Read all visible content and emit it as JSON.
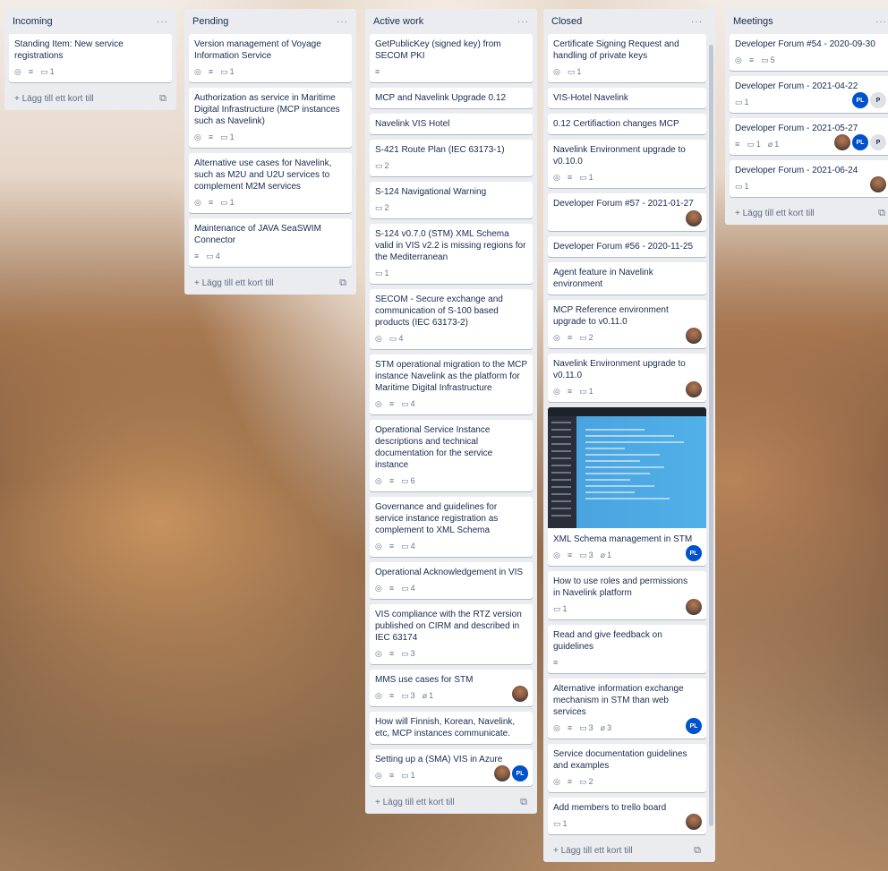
{
  "labels": {
    "add_card": "+ Lägg till ett kort till",
    "menu": "···"
  },
  "lists": [
    {
      "title": "Incoming",
      "cards": [
        {
          "title": "Standing Item: New service registrations",
          "badges": {
            "watch": true,
            "desc": true,
            "comments": "1"
          }
        }
      ]
    },
    {
      "title": "Pending",
      "cards": [
        {
          "title": "Version management of Voyage Information Service",
          "badges": {
            "watch": true,
            "desc": true,
            "comments": "1"
          }
        },
        {
          "title": "Authorization as service in Maritime Digital Infrastructure (MCP instances such as Navelink)",
          "badges": {
            "watch": true,
            "desc": true,
            "comments": "1"
          }
        },
        {
          "title": "Alternative use cases for Navelink, such as M2U and U2U services to complement M2M services",
          "badges": {
            "watch": true,
            "desc": true,
            "comments": "1"
          }
        },
        {
          "title": "Maintenance of JAVA SeaSWIM Connector",
          "badges": {
            "desc": true,
            "comments": "4"
          }
        }
      ]
    },
    {
      "title": "Active work",
      "cards": [
        {
          "title": "GetPublicKey (signed key) from SECOM PKI",
          "badges": {
            "desc": true
          }
        },
        {
          "title": "MCP and Navelink Upgrade 0.12"
        },
        {
          "title": "Navelink VIS Hotel"
        },
        {
          "title": "S-421 Route Plan (IEC 63173-1)",
          "badges": {
            "comments": "2"
          }
        },
        {
          "title": "S-124 Navigational Warning",
          "badges": {
            "comments": "2"
          }
        },
        {
          "title": "S-124 v0.7.0 (STM) XML Schema valid in VIS v2.2 is missing regions for the Mediterranean",
          "badges": {
            "comments": "1"
          }
        },
        {
          "title": "SECOM - Secure exchange and communication of S-100 based products (IEC 63173-2)",
          "badges": {
            "watch": true,
            "comments": "4"
          }
        },
        {
          "title": "STM operational migration to the MCP instance Navelink as the platform for Maritime Digital Infrastructure",
          "badges": {
            "watch": true,
            "desc": true,
            "comments": "4"
          }
        },
        {
          "title": "Operational Service Instance descriptions and technical documentation for the service instance",
          "badges": {
            "watch": true,
            "desc": true,
            "comments": "6"
          }
        },
        {
          "title": "Governance and guidelines for service instance registration as complement to XML Schema",
          "badges": {
            "watch": true,
            "desc": true,
            "comments": "4"
          }
        },
        {
          "title": "Operational Acknowledgement in VIS",
          "badges": {
            "watch": true,
            "desc": true,
            "comments": "4"
          }
        },
        {
          "title": "VIS compliance with the RTZ version published on CIRM and described in IEC 63174",
          "badges": {
            "watch": true,
            "desc": true,
            "comments": "3"
          }
        },
        {
          "title": "MMS use cases for STM",
          "badges": {
            "watch": true,
            "desc": true,
            "comments": "3",
            "attachments": "1"
          },
          "members": [
            "photo"
          ]
        },
        {
          "title": "How will Finnish, Korean, Navelink, etc, MCP instances communicate."
        },
        {
          "title": "Setting up a (SMA) VIS in Azure",
          "badges": {
            "watch": true,
            "desc": true,
            "comments": "1"
          },
          "members": [
            "photo",
            "PL"
          ]
        }
      ]
    },
    {
      "title": "Closed",
      "cards": [
        {
          "title": "Certificate Signing Request and handling of private keys",
          "badges": {
            "watch": true,
            "comments": "1"
          }
        },
        {
          "title": "VIS-Hotel Navelink"
        },
        {
          "title": "0.12 Certifiaction changes MCP"
        },
        {
          "title": "Navelink Environment upgrade to v0.10.0",
          "badges": {
            "watch": true,
            "desc": true,
            "comments": "1"
          }
        },
        {
          "title": "Developer Forum #57 - 2021-01-27",
          "members": [
            "photo"
          ]
        },
        {
          "title": "Developer Forum #56 - 2020-11-25"
        },
        {
          "title": "Agent feature in Navelink environment"
        },
        {
          "title": "MCP Reference environment upgrade to v0.11.0",
          "badges": {
            "watch": true,
            "desc": true,
            "comments": "2"
          },
          "members": [
            "photo"
          ]
        },
        {
          "title": "Navelink Environment upgrade to v0.11.0",
          "badges": {
            "watch": true,
            "desc": true,
            "comments": "1"
          },
          "members": [
            "photo"
          ]
        },
        {
          "title": "XML Schema management in STM",
          "cover": true,
          "badges": {
            "watch": true,
            "desc": true,
            "comments": "3",
            "attachments": "1"
          },
          "members": [
            "PL"
          ]
        },
        {
          "title": "How to use roles and permissions in Navelink platform",
          "badges": {
            "comments": "1"
          },
          "members": [
            "photo"
          ]
        },
        {
          "title": "Read and give feedback on guidelines",
          "badges": {
            "desc": true
          }
        },
        {
          "title": "Alternative information exchange mechanism in STM than web services",
          "badges": {
            "watch": true,
            "desc": true,
            "comments": "3",
            "attachments": "3"
          },
          "members": [
            "PL"
          ]
        },
        {
          "title": "Service documentation guidelines and examples",
          "badges": {
            "watch": true,
            "desc": true,
            "comments": "2"
          }
        },
        {
          "title": "Add members to trello board",
          "badges": {
            "comments": "1"
          },
          "members": [
            "photo"
          ]
        }
      ]
    },
    {
      "title": "Meetings",
      "cards": [
        {
          "title": "Developer Forum #54 - 2020-09-30",
          "badges": {
            "watch": true,
            "desc": true,
            "comments": "5"
          }
        },
        {
          "title": "Developer Forum - 2021-04-22",
          "badges": {
            "comments": "1"
          },
          "members": [
            "PL",
            "P"
          ]
        },
        {
          "title": "Developer Forum - 2021-05-27",
          "badges": {
            "desc": true,
            "comments": "1",
            "attachments": "1"
          },
          "members": [
            "photo",
            "PL",
            "P"
          ]
        },
        {
          "title": "Developer Forum - 2021-06-24",
          "badges": {
            "comments": "1"
          },
          "members": [
            "photo"
          ]
        }
      ]
    }
  ]
}
